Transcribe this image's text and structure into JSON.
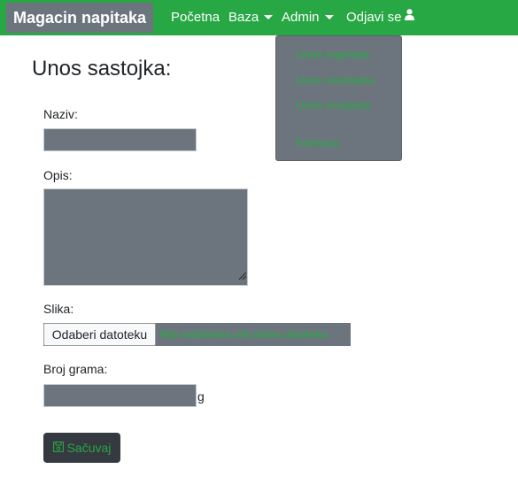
{
  "navbar": {
    "brand": "Magacin napitaka",
    "items": [
      {
        "label": "Početna"
      },
      {
        "label": "Baza"
      },
      {
        "label": "Admin"
      },
      {
        "label": "Odjavi se"
      }
    ],
    "color": "#28a745"
  },
  "dropdown": {
    "items": [
      {
        "label": "Unos napitaka"
      },
      {
        "label": "Unos sastojaka"
      },
      {
        "label": "Unos recepata"
      },
      {
        "label": "Korisnici"
      }
    ]
  },
  "form": {
    "title": "Unos sastojka:",
    "naziv": {
      "label": "Naziv:",
      "value": ""
    },
    "opis": {
      "label": "Opis:",
      "value": ""
    },
    "slika": {
      "label": "Slika:",
      "button_label": "Odaberi datoteku",
      "status": "Nije odabrana niti jedna datoteka"
    },
    "broj_grama": {
      "label": "Broj grama:",
      "value": "",
      "unit": "g"
    },
    "save_label": "Sačuvaj"
  },
  "icons": {
    "user": "user-icon",
    "save": "floppy-disk-icon",
    "caret": "caret-down-icon"
  }
}
